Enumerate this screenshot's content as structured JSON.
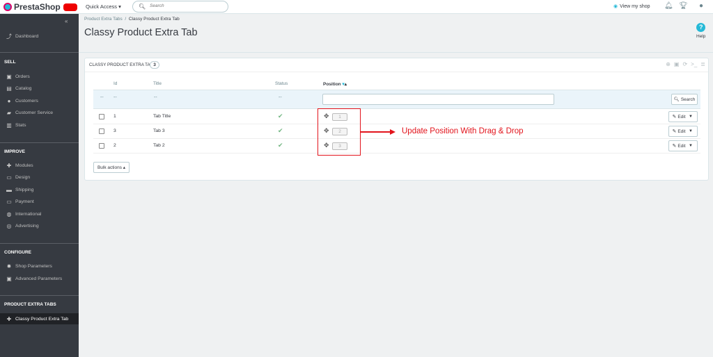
{
  "topbar": {
    "logo_text": "PrestaShop",
    "quick_access": "Quick Access",
    "search_placeholder": "Search",
    "view_my_shop": "View my shop"
  },
  "sidebar": {
    "dashboard": "Dashboard",
    "sell_head": "SELL",
    "orders": "Orders",
    "catalog": "Catalog",
    "customers": "Customers",
    "customer_service": "Customer Service",
    "stats": "Stats",
    "improve_head": "IMPROVE",
    "modules": "Modules",
    "design": "Design",
    "shipping": "Shipping",
    "payment": "Payment",
    "international": "International",
    "advertising": "Advertising",
    "configure_head": "CONFIGURE",
    "shop_parameters": "Shop Parameters",
    "advanced_parameters": "Advanced Parameters",
    "pet_head": "PRODUCT EXTRA TABS",
    "classy_tab": "Classy Product Extra Tab"
  },
  "breadcrumb": {
    "parent": "Product Extra Tabs",
    "sep": "/",
    "current": "Classy Product Extra Tab"
  },
  "page": {
    "title": "Classy Product Extra Tab",
    "help": "Help"
  },
  "panel": {
    "title": "CLASSY PRODUCT EXTRA TAB",
    "count": "3",
    "columns": {
      "id": "Id",
      "title": "Title",
      "status": "Status",
      "position": "Position"
    },
    "filter_dash": "--",
    "search_button": "Search",
    "rows": [
      {
        "id": "1",
        "title": "Tab Title",
        "position": "1"
      },
      {
        "id": "3",
        "title": "Tab 3",
        "position": "2"
      },
      {
        "id": "2",
        "title": "Tab 2",
        "position": "3"
      }
    ],
    "edit_label": "Edit",
    "bulk_actions": "Bulk actions"
  },
  "annotation": {
    "text": "Update Position With Drag & Drop",
    "color": "#e2131b"
  },
  "colors": {
    "sidebar": "#363a41",
    "accent": "#25b9d7",
    "status_green": "#70b580"
  }
}
